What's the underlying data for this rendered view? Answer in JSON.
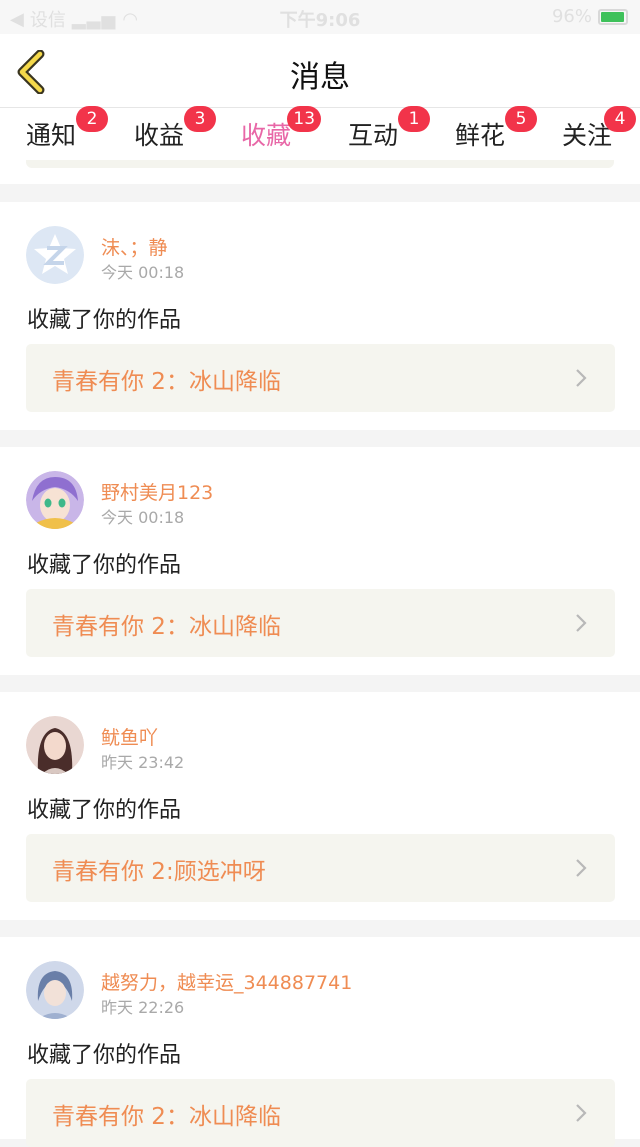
{
  "status_bar": {
    "carrier": "设信",
    "time": "下午9:06",
    "battery_text": "96%",
    "battery_level": 0.96
  },
  "nav": {
    "title": "消息"
  },
  "tabs": [
    {
      "label": "通知",
      "badge": "2"
    },
    {
      "label": "收益",
      "badge": "3"
    },
    {
      "label": "收藏",
      "badge": "13",
      "active": true
    },
    {
      "label": "互动",
      "badge": "1"
    },
    {
      "label": "鲜花",
      "badge": "5"
    },
    {
      "label": "关注",
      "badge": "4"
    }
  ],
  "messages": [
    {
      "user": "沫、；静",
      "time": "今天 00:18",
      "action": "收藏了你的作品",
      "work": "青春有你 2：冰山降临"
    },
    {
      "user": "野村美月123",
      "time": "今天 00:18",
      "action": "收藏了你的作品",
      "work": "青春有你 2：冰山降临"
    },
    {
      "user": "鱿鱼吖",
      "time": "昨天 23:42",
      "action": "收藏了你的作品",
      "work": "青春有你 2:顾选冲呀"
    },
    {
      "user": "越努力，越幸运_344887741",
      "time": "昨天 22:26",
      "action": "收藏了你的作品",
      "work": "青春有你 2：冰山降临"
    }
  ],
  "colors": {
    "accent_pink": "#e867a7",
    "badge_red": "#f2344a",
    "username_orange": "#ef8c53",
    "back_arrow_yellow": "#f5d94a"
  }
}
